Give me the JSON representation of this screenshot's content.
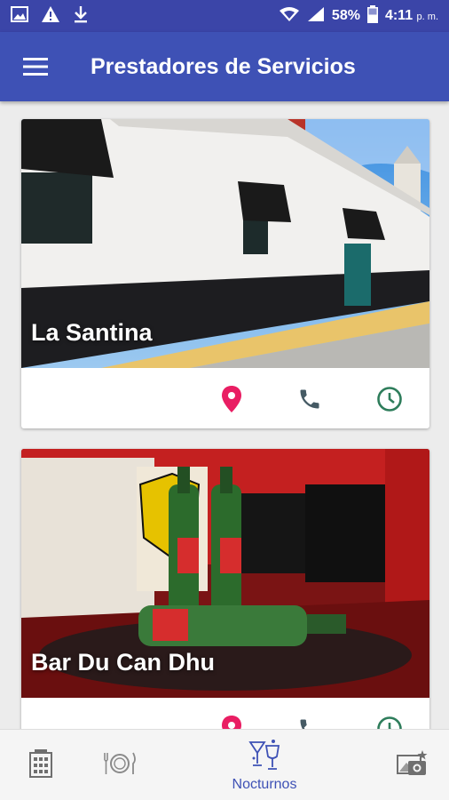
{
  "status_bar": {
    "battery": "58%",
    "time": "4:11",
    "ampm": "p. m.",
    "icons": [
      "image-icon",
      "warning-icon",
      "download-icon",
      "wifi-icon",
      "signal-icon",
      "battery-icon"
    ]
  },
  "app_bar": {
    "title": "Prestadores de Servicios",
    "menu_icon": "hamburger-menu-icon"
  },
  "cards": [
    {
      "name": "La Santina",
      "actions": [
        "location-icon",
        "phone-icon",
        "clock-icon"
      ]
    },
    {
      "name": "Bar Du Can Dhu",
      "actions": [
        "location-icon",
        "phone-icon",
        "clock-icon"
      ]
    }
  ],
  "bottom_nav": {
    "active_label": "Nocturnos",
    "items": [
      "hotel-icon",
      "restaurant-icon",
      "nightlife-icon",
      "photo-icon"
    ]
  },
  "colors": {
    "status_bar": "#3b45a8",
    "app_bar": "#3e51b5",
    "location": "#e91e63",
    "phone": "#455a64",
    "clock": "#2e7d5b",
    "nav_active": "#3e51b5"
  }
}
